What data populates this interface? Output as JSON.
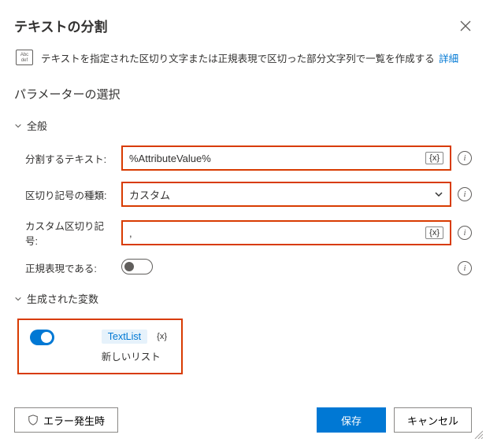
{
  "header": {
    "title": "テキストの分割"
  },
  "info": {
    "text": "テキストを指定された区切り文字または正規表現で区切った部分文字列で一覧を作成する",
    "link_label": "詳細",
    "icon_line1": "Abc",
    "icon_line2": "def"
  },
  "sections": {
    "param_heading": "パラメーターの選択",
    "general": "全般",
    "generated": "生成された変数"
  },
  "fields": {
    "split_text": {
      "label": "分割するテキスト:",
      "value": "%AttributeValue%"
    },
    "delimiter_type": {
      "label": "区切り記号の種類:",
      "value": "カスタム"
    },
    "custom_delimiter": {
      "label": "カスタム区切り記号:",
      "value": ","
    },
    "is_regex": {
      "label": "正規表現である:"
    }
  },
  "badges": {
    "fx": "{x}"
  },
  "generated_variable": {
    "name": "TextList",
    "desc": "新しいリスト"
  },
  "footer": {
    "on_error": "エラー発生時",
    "save": "保存",
    "cancel": "キャンセル"
  }
}
